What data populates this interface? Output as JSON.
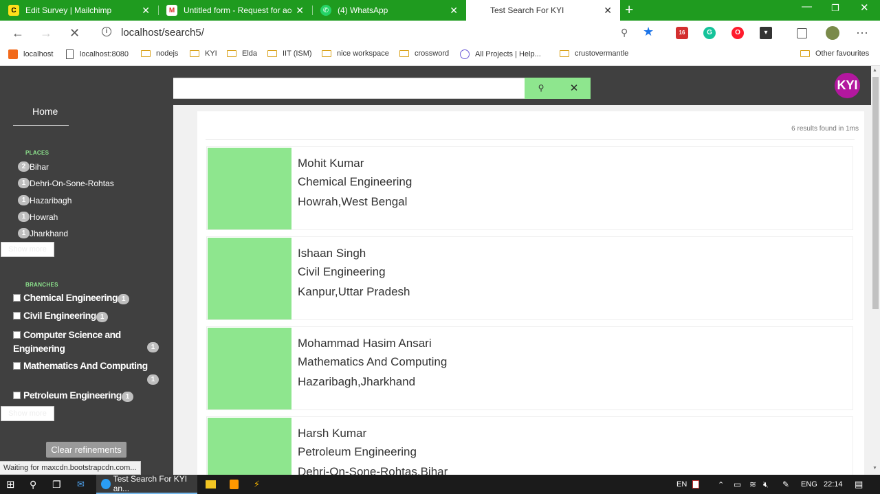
{
  "browser": {
    "tabs": [
      {
        "title": "Edit Survey | Mailchimp",
        "icon": "mailchimp-icon",
        "color": "#ffe01b"
      },
      {
        "title": "Untitled form - Request for acce",
        "icon": "gmail-icon",
        "color": "#ffffff"
      },
      {
        "title": "(4) WhatsApp",
        "icon": "whatsapp-icon",
        "color": "#25d366"
      },
      {
        "title": "Test Search For KYI",
        "active": true
      }
    ],
    "url": "localhost/search5/",
    "bookmarks": [
      "localhost",
      "localhost:8080",
      "nodejs",
      "KYI",
      "Elda",
      "IIT (ISM)",
      "nice workspace",
      "crossword",
      "All Projects | Help...",
      "crustovermantle",
      "Other favourites"
    ],
    "extension_badge": "16"
  },
  "sidebar": {
    "home": "Home",
    "places_title": "PLACES",
    "places": [
      {
        "count": "2",
        "label": "Bihar"
      },
      {
        "count": "1",
        "label": "Dehri-On-Sone-Rohtas"
      },
      {
        "count": "1",
        "label": "Hazaribagh"
      },
      {
        "count": "1",
        "label": "Howrah"
      },
      {
        "count": "1",
        "label": "Jharkhand"
      }
    ],
    "show_more": "Show more",
    "branches_title": "BRANCHES",
    "branches": [
      {
        "label": "Chemical Engineering",
        "count": "1",
        "checked": false
      },
      {
        "label": "Civil Engineering",
        "count": "1",
        "checked": false
      },
      {
        "label": "Computer Science and Engineering",
        "count": "1",
        "checked": false
      },
      {
        "label": "Mathematics And Computing",
        "count": "1",
        "checked": false
      },
      {
        "label": "Petroleum Engineering",
        "count": "1",
        "checked": false
      }
    ],
    "clear": "Clear refinements"
  },
  "search": {
    "placeholder": "",
    "value": "",
    "logo": "KYI"
  },
  "results": {
    "stats": "6 results found in 1ms",
    "hits": [
      {
        "name": "Mohit Kumar",
        "branch": "Chemical Engineering",
        "location": "Howrah,West Bengal"
      },
      {
        "name": "Ishaan Singh",
        "branch": "Civil Engineering",
        "location": "Kanpur,Uttar Pradesh"
      },
      {
        "name": "Mohammad Hasim Ansari",
        "branch": "Mathematics And Computing",
        "location": "Hazaribagh,Jharkhand"
      },
      {
        "name": "Harsh Kumar",
        "branch": "Petroleum Engineering",
        "location": "Dehri-On-Sone-Rohtas,Bihar"
      }
    ]
  },
  "status_text": "Waiting for maxcdn.bootstrapcdn.com...",
  "taskbar": {
    "active_window": "Test Search For KYI an...",
    "lang": "EN",
    "input": "ENG",
    "time": "22:14"
  },
  "colors": {
    "accent_green": "#8ee68e",
    "sidebar_bg": "#404040",
    "browser_green": "#1f9b1f",
    "logo": "#b3179f"
  }
}
